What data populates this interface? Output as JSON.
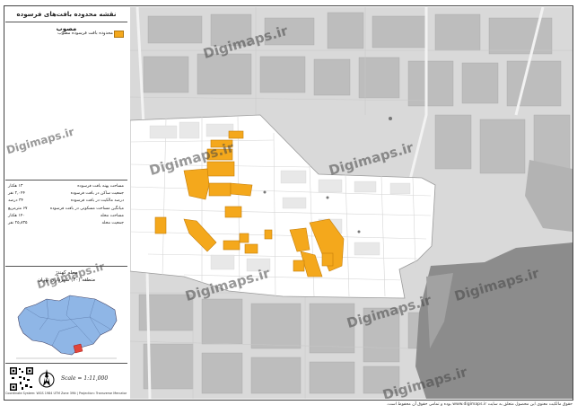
{
  "panel": {
    "title": "نقشه محدوده بافت‌های فرسوده مصوب",
    "legend_label": "محدوده بافت فرسوده مصوب",
    "stats": [
      {
        "label": "مساحت پهنه بافت فرسوده",
        "value": "۱۳ هکتار"
      },
      {
        "label": "جمعیت ساکن در بافت فرسوده",
        "value": "۲,۰۴۴ نفر"
      },
      {
        "label": "درصد مالکیت در بافت فرسوده",
        "value": "۳۴ درصد"
      },
      {
        "label": "میانگین مساحت مسکونی در بافت فرسوده",
        "value": "۶۷ مترمربع"
      },
      {
        "label": "مساحت محله",
        "value": "۱۴۰ هکتار"
      },
      {
        "label": "جمعیت محله",
        "value": "۲۵,۸۳۵ نفر"
      }
    ],
    "region_name": "محله کهندژ",
    "region_sub": "منطقه (۲۰) شهرداری تهران",
    "scale": "Scale = 1:11,000",
    "footer_left": "Coordinate System: WGS 1984 UTM Zone 39N | Projection: Transverse Mercator"
  },
  "map": {
    "watermark": "Digimaps.ir",
    "footer": "حقوق مالکیت معنوی این محصول متعلق به سایت www.digimaps.ir بوده و تمامی حقوق آن محفوظ است."
  },
  "colors": {
    "highlight": "#f4a81c",
    "background": "#d9d9d9",
    "neighborhood": "#ffffff",
    "inset_fill": "#8fb6e6"
  }
}
